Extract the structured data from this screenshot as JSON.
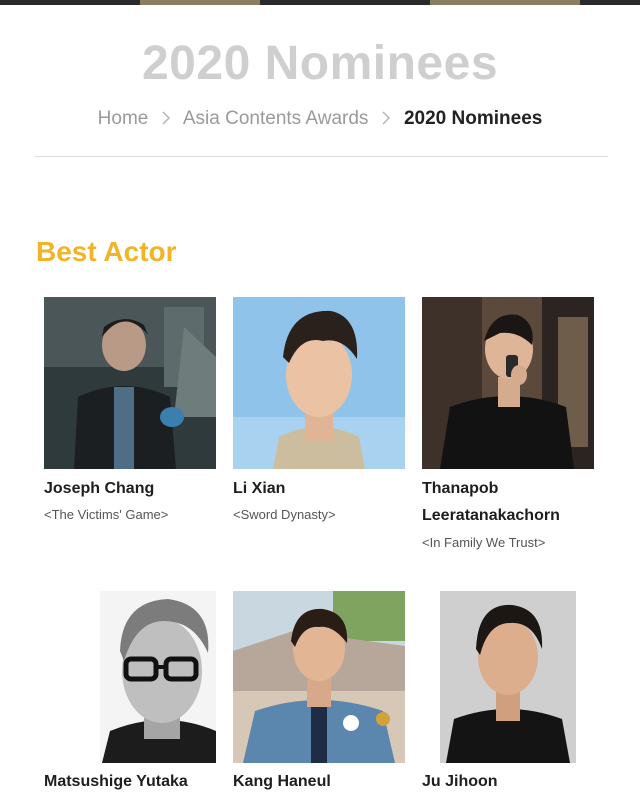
{
  "header": {
    "title": "2020 Nominees"
  },
  "breadcrumb": {
    "home": "Home",
    "section": "Asia Contents Awards",
    "current": "2020 Nominees"
  },
  "category": {
    "title": "Best Actor"
  },
  "nominees": [
    {
      "name": "Joseph Chang",
      "work": "<The Victims' Game>"
    },
    {
      "name": "Li Xian",
      "work": "<Sword Dynasty>"
    },
    {
      "name_line1": "Thanapob",
      "name_line2": "Leeratanakachorn",
      "work": "<In Family We Trust>"
    },
    {
      "name": "Matsushige Yutaka"
    },
    {
      "name": "Kang Haneul"
    },
    {
      "name": "Ju Jihoon"
    }
  ],
  "colors": {
    "accent": "#f0b429",
    "title_gray": "#cfcfcf"
  }
}
